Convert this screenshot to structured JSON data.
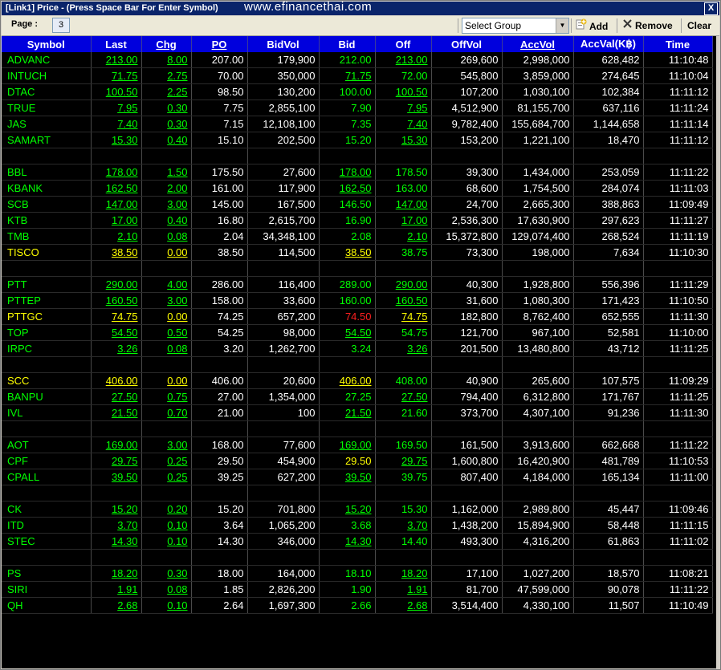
{
  "window": {
    "title": "[Link1] Price  - (Press Space Bar For Enter Symbol)",
    "watermark": "www.efinancethai.com",
    "close_label": "X"
  },
  "toolbar": {
    "page_label": "Page :",
    "page_value": "3",
    "group_value": "Select Group",
    "add_label": "Add",
    "remove_label": "Remove",
    "clear_label": "Clear"
  },
  "columns": [
    "Symbol",
    "Last",
    "Chg",
    "PO",
    "BidVol",
    "Bid",
    "Off",
    "OffVol",
    "AccVol",
    "AccVal(K฿)",
    "Time"
  ],
  "groups": [
    [
      [
        "ADVANC",
        "g",
        "213.00",
        "gu",
        "8.00",
        "gu",
        "207.00",
        "w",
        "179,900",
        "w",
        "212.00",
        "g",
        "213.00",
        "gu",
        "269,600",
        "w",
        "2,998,000",
        "w",
        "628,482",
        "w",
        "11:10:48",
        "w"
      ],
      [
        "INTUCH",
        "g",
        "71.75",
        "gu",
        "2.75",
        "gu",
        "70.00",
        "w",
        "350,000",
        "w",
        "71.75",
        "gu",
        "72.00",
        "g",
        "545,800",
        "w",
        "3,859,000",
        "w",
        "274,645",
        "w",
        "11:10:04",
        "w"
      ],
      [
        "DTAC",
        "g",
        "100.50",
        "gu",
        "2.25",
        "gu",
        "98.50",
        "w",
        "130,200",
        "w",
        "100.00",
        "g",
        "100.50",
        "gu",
        "107,200",
        "w",
        "1,030,100",
        "w",
        "102,384",
        "w",
        "11:11:12",
        "w"
      ],
      [
        "TRUE",
        "g",
        "7.95",
        "gu",
        "0.30",
        "gu",
        "7.75",
        "w",
        "2,855,100",
        "w",
        "7.90",
        "g",
        "7.95",
        "gu",
        "4,512,900",
        "w",
        "81,155,700",
        "w",
        "637,116",
        "w",
        "11:11:24",
        "w"
      ],
      [
        "JAS",
        "g",
        "7.40",
        "gu",
        "0.30",
        "gu",
        "7.15",
        "w",
        "12,108,100",
        "w",
        "7.35",
        "g",
        "7.40",
        "gu",
        "9,782,400",
        "w",
        "155,684,700",
        "w",
        "1,144,658",
        "w",
        "11:11:14",
        "w"
      ],
      [
        "SAMART",
        "g",
        "15.30",
        "gu",
        "0.40",
        "gu",
        "15.10",
        "w",
        "202,500",
        "w",
        "15.20",
        "g",
        "15.30",
        "gu",
        "153,200",
        "w",
        "1,221,100",
        "w",
        "18,470",
        "w",
        "11:11:12",
        "w"
      ]
    ],
    [
      [
        "BBL",
        "g",
        "178.00",
        "gu",
        "1.50",
        "gu",
        "175.50",
        "w",
        "27,600",
        "w",
        "178.00",
        "gu",
        "178.50",
        "g",
        "39,300",
        "w",
        "1,434,000",
        "w",
        "253,059",
        "w",
        "11:11:22",
        "w"
      ],
      [
        "KBANK",
        "g",
        "162.50",
        "gu",
        "2.00",
        "gu",
        "161.00",
        "w",
        "117,900",
        "w",
        "162.50",
        "gu",
        "163.00",
        "g",
        "68,600",
        "w",
        "1,754,500",
        "w",
        "284,074",
        "w",
        "11:11:03",
        "w"
      ],
      [
        "SCB",
        "g",
        "147.00",
        "gu",
        "3.00",
        "gu",
        "145.00",
        "w",
        "167,500",
        "w",
        "146.50",
        "g",
        "147.00",
        "gu",
        "24,700",
        "w",
        "2,665,300",
        "w",
        "388,863",
        "w",
        "11:09:49",
        "w"
      ],
      [
        "KTB",
        "g",
        "17.00",
        "gu",
        "0.40",
        "gu",
        "16.80",
        "w",
        "2,615,700",
        "w",
        "16.90",
        "g",
        "17.00",
        "gu",
        "2,536,300",
        "w",
        "17,630,900",
        "w",
        "297,623",
        "w",
        "11:11:27",
        "w"
      ],
      [
        "TMB",
        "g",
        "2.10",
        "gu",
        "0.08",
        "gu",
        "2.04",
        "w",
        "34,348,100",
        "w",
        "2.08",
        "g",
        "2.10",
        "gu",
        "15,372,800",
        "w",
        "129,074,400",
        "w",
        "268,524",
        "w",
        "11:11:19",
        "w"
      ],
      [
        "TISCO",
        "y",
        "38.50",
        "yu",
        "0.00",
        "yu",
        "38.50",
        "w",
        "114,500",
        "w",
        "38.50",
        "yu",
        "38.75",
        "g",
        "73,300",
        "w",
        "198,000",
        "w",
        "7,634",
        "w",
        "11:10:30",
        "w"
      ]
    ],
    [
      [
        "PTT",
        "g",
        "290.00",
        "gu",
        "4.00",
        "gu",
        "286.00",
        "w",
        "116,400",
        "w",
        "289.00",
        "g",
        "290.00",
        "gu",
        "40,300",
        "w",
        "1,928,800",
        "w",
        "556,396",
        "w",
        "11:11:29",
        "w"
      ],
      [
        "PTTEP",
        "g",
        "160.50",
        "gu",
        "3.00",
        "gu",
        "158.00",
        "w",
        "33,600",
        "w",
        "160.00",
        "g",
        "160.50",
        "gu",
        "31,600",
        "w",
        "1,080,300",
        "w",
        "171,423",
        "w",
        "11:10:50",
        "w"
      ],
      [
        "PTTGC",
        "y",
        "74.75",
        "yu",
        "0.00",
        "yu",
        "74.25",
        "w",
        "657,200",
        "w",
        "74.50",
        "r",
        "74.75",
        "yu",
        "182,800",
        "w",
        "8,762,400",
        "w",
        "652,555",
        "w",
        "11:11:30",
        "w"
      ],
      [
        "TOP",
        "g",
        "54.50",
        "gu",
        "0.50",
        "gu",
        "54.25",
        "w",
        "98,000",
        "w",
        "54.50",
        "gu",
        "54.75",
        "g",
        "121,700",
        "w",
        "967,100",
        "w",
        "52,581",
        "w",
        "11:10:00",
        "w"
      ],
      [
        "IRPC",
        "g",
        "3.26",
        "gu",
        "0.08",
        "gu",
        "3.20",
        "w",
        "1,262,700",
        "w",
        "3.24",
        "g",
        "3.26",
        "gu",
        "201,500",
        "w",
        "13,480,800",
        "w",
        "43,712",
        "w",
        "11:11:25",
        "w"
      ]
    ],
    [
      [
        "SCC",
        "y",
        "406.00",
        "yu",
        "0.00",
        "yu",
        "406.00",
        "w",
        "20,600",
        "w",
        "406.00",
        "yu",
        "408.00",
        "g",
        "40,900",
        "w",
        "265,600",
        "w",
        "107,575",
        "w",
        "11:09:29",
        "w"
      ],
      [
        "BANPU",
        "g",
        "27.50",
        "gu",
        "0.75",
        "gu",
        "27.00",
        "w",
        "1,354,000",
        "w",
        "27.25",
        "g",
        "27.50",
        "gu",
        "794,400",
        "w",
        "6,312,800",
        "w",
        "171,767",
        "w",
        "11:11:25",
        "w"
      ],
      [
        "IVL",
        "g",
        "21.50",
        "gu",
        "0.70",
        "gu",
        "21.00",
        "w",
        "100",
        "w",
        "21.50",
        "gu",
        "21.60",
        "g",
        "373,700",
        "w",
        "4,307,100",
        "w",
        "91,236",
        "w",
        "11:11:30",
        "w"
      ]
    ],
    [
      [
        "AOT",
        "g",
        "169.00",
        "gu",
        "3.00",
        "gu",
        "168.00",
        "w",
        "77,600",
        "w",
        "169.00",
        "gu",
        "169.50",
        "g",
        "161,500",
        "w",
        "3,913,600",
        "w",
        "662,668",
        "w",
        "11:11:22",
        "w"
      ],
      [
        "CPF",
        "g",
        "29.75",
        "gu",
        "0.25",
        "gu",
        "29.50",
        "w",
        "454,900",
        "w",
        "29.50",
        "y",
        "29.75",
        "gu",
        "1,600,800",
        "w",
        "16,420,900",
        "w",
        "481,789",
        "w",
        "11:10:53",
        "w"
      ],
      [
        "CPALL",
        "g",
        "39.50",
        "gu",
        "0.25",
        "gu",
        "39.25",
        "w",
        "627,200",
        "w",
        "39.50",
        "gu",
        "39.75",
        "g",
        "807,400",
        "w",
        "4,184,000",
        "w",
        "165,134",
        "w",
        "11:11:00",
        "w"
      ]
    ],
    [
      [
        "CK",
        "g",
        "15.20",
        "gu",
        "0.20",
        "gu",
        "15.20",
        "w",
        "701,800",
        "w",
        "15.20",
        "gu",
        "15.30",
        "g",
        "1,162,000",
        "w",
        "2,989,800",
        "w",
        "45,447",
        "w",
        "11:09:46",
        "w"
      ],
      [
        "ITD",
        "g",
        "3.70",
        "gu",
        "0.10",
        "gu",
        "3.64",
        "w",
        "1,065,200",
        "w",
        "3.68",
        "g",
        "3.70",
        "gu",
        "1,438,200",
        "w",
        "15,894,900",
        "w",
        "58,448",
        "w",
        "11:11:15",
        "w"
      ],
      [
        "STEC",
        "g",
        "14.30",
        "gu",
        "0.10",
        "gu",
        "14.30",
        "w",
        "346,000",
        "w",
        "14.30",
        "gu",
        "14.40",
        "g",
        "493,300",
        "w",
        "4,316,200",
        "w",
        "61,863",
        "w",
        "11:11:02",
        "w"
      ]
    ],
    [
      [
        "PS",
        "g",
        "18.20",
        "gu",
        "0.30",
        "gu",
        "18.00",
        "w",
        "164,000",
        "w",
        "18.10",
        "g",
        "18.20",
        "gu",
        "17,100",
        "w",
        "1,027,200",
        "w",
        "18,570",
        "w",
        "11:08:21",
        "w"
      ],
      [
        "SIRI",
        "g",
        "1.91",
        "gu",
        "0.08",
        "gu",
        "1.85",
        "w",
        "2,826,200",
        "w",
        "1.90",
        "g",
        "1.91",
        "gu",
        "81,700",
        "w",
        "47,599,000",
        "w",
        "90,078",
        "w",
        "11:11:22",
        "w"
      ],
      [
        "QH",
        "g",
        "2.68",
        "gu",
        "0.10",
        "gu",
        "2.64",
        "w",
        "1,697,300",
        "w",
        "2.66",
        "g",
        "2.68",
        "gu",
        "3,514,400",
        "w",
        "4,330,100",
        "w",
        "11,507",
        "w",
        "11:10:49",
        "w"
      ]
    ]
  ]
}
